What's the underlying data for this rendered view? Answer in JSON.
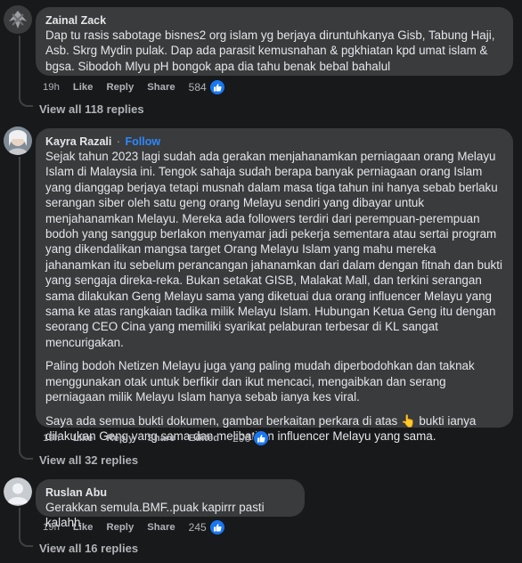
{
  "comments": [
    {
      "author": "Zainal Zack",
      "body": [
        "Dap tu rasis sabotage bisnes2 org islam yg berjaya diruntuhkanya Gisb, Tabung Haji, Asb. Skrg Mydin pulak. Dap ada parasit kemusnahan & pgkhiatan kpd umat islam & bgsa. Sibodoh Mlyu pH bongok apa dia tahu benak bebal bahalul"
      ],
      "time": "19h",
      "like": "Like",
      "reply": "Reply",
      "share": "Share",
      "count": "584",
      "view_replies": "View all 118 replies"
    },
    {
      "author": "Kayra Razali",
      "follow_sep": "·",
      "follow": "Follow",
      "body": [
        "Sejak tahun 2023 lagi sudah ada gerakan menjahanamkan perniagaan orang Melayu Islam di Malaysia ini. Tengok sahaja sudah berapa banyak perniagaan orang Islam yang dianggap berjaya tetapi musnah dalam masa tiga tahun ini hanya sebab berlaku serangan siber oleh satu geng orang Melayu sendiri yang dibayar untuk menjahanamkan Melayu. Mereka ada followers terdiri dari perempuan-perempuan bodoh yang sanggup berlakon menyamar jadi pekerja sementara atau sertai program yang dikendalikan mangsa target Orang Melayu Islam yang mahu mereka jahanamkan itu sebelum perancangan jahanamkan dari dalam dengan fitnah dan bukti yang sengaja direka-reka. Bukan setakat GISB, Malakat Mall, dan terkini serangan sama dilakukan Geng Melayu sama yang diketuai dua orang influencer Melayu yang sama ke atas rangkaian tadika milik Melayu Islam. Hubungan Ketua Geng itu dengan seorang CEO Cina yang memiliki syarikat pelaburan terbesar di KL sangat mencurigakan.",
        "Paling bodoh Netizen Melayu juga yang paling mudah diperbodohkan dan taknak menggunakan otak untuk berfikir dan ikut mencaci, mengaibkan dan serang perniagaan milik Melayu Islam hanya sebab ianya kes viral.",
        "Saya ada semua bukti dokumen, gambar berkaitan perkara di atas 👆 bukti ianya dilakukan Geng yang sama dan melibatkan influencer Melayu yang sama."
      ],
      "time": "19h",
      "like": "Like",
      "reply": "Reply",
      "share": "Share",
      "edited": "Edited",
      "count": "296",
      "view_replies": "View all 32 replies"
    },
    {
      "author": "Ruslan Abu",
      "body": [
        "Gerakkan semula.BMF..puak kapirrr pasti kalahh"
      ],
      "time": "19h",
      "like": "Like",
      "reply": "Reply",
      "share": "Share",
      "count": "245",
      "view_replies": "View all 16 replies"
    }
  ],
  "colors": {
    "background": "#18191a",
    "bubble": "#3a3b3c",
    "link": "#2d88ff",
    "like_badge": "#1877f2",
    "muted": "#b0b3b8"
  },
  "icons": [
    "avatar",
    "thumbs-up-icon"
  ]
}
